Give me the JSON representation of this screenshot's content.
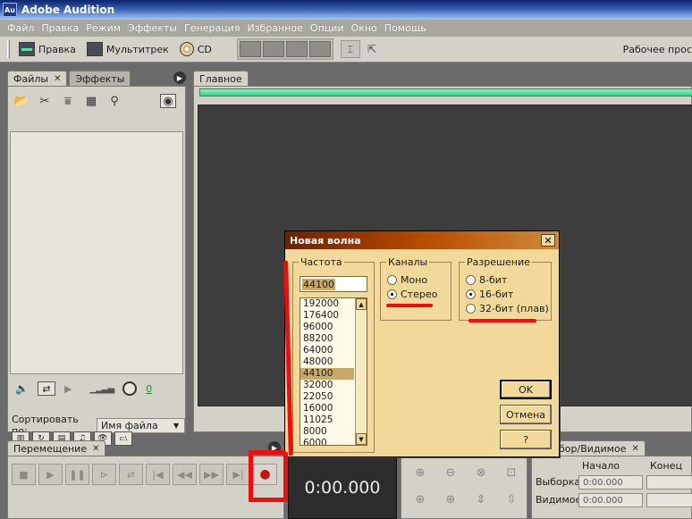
{
  "window": {
    "title": "Adobe Audition",
    "icon_text": "Au"
  },
  "menu": [
    "Файл",
    "Правка",
    "Режим",
    "Эффекты",
    "Генерация",
    "Избранное",
    "Опции",
    "Окно",
    "Помощь"
  ],
  "toolbar": {
    "edit_label": "Правка",
    "multitrack_label": "Мультитрек",
    "cd_label": "CD",
    "workspace_label": "Рабочее прос"
  },
  "files_panel": {
    "tab_files": "Файлы",
    "tab_effects": "Эффекты",
    "sort_label": "Сортировать по:",
    "sort_value": "Имя файла",
    "volume_value": "0"
  },
  "main_panel": {
    "tab_label": "Главное"
  },
  "transport": {
    "tab_label": "Перемещение",
    "time": "0:00.000"
  },
  "selection": {
    "tab_label": "бор/Видимое",
    "col_start": "Начало",
    "col_end": "Конец",
    "row_selection": "Выборка",
    "row_visible": "Видимое",
    "selection_start": "0:00.000",
    "visible_start": "0:00.000"
  },
  "dialog": {
    "title": "Новая волна",
    "close_symbol": "✕",
    "rate_group": "Частота",
    "rate_value": "44100",
    "rates": [
      "192000",
      "176400",
      "96000",
      "88200",
      "64000",
      "48000",
      "44100",
      "32000",
      "22050",
      "16000",
      "11025",
      "8000",
      "6000"
    ],
    "selected_rate": "44100",
    "channels_group": "Каналы",
    "channels": [
      {
        "label": "Моно",
        "checked": false
      },
      {
        "label": "Стерео",
        "checked": true
      }
    ],
    "resolution_group": "Разрешение",
    "resolutions": [
      {
        "label": "8-бит",
        "checked": false
      },
      {
        "label": "16-бит",
        "checked": true
      },
      {
        "label": "32-бит (плав)",
        "checked": false
      }
    ],
    "ok_label": "OK",
    "cancel_label": "Отмена",
    "help_label": "?"
  },
  "colors": {
    "annotation": "#f20d0d",
    "dialog_bg": "#f0d99a",
    "title_gradient_start": "#6e2000",
    "waveform_bg": "#3d3d3d"
  }
}
